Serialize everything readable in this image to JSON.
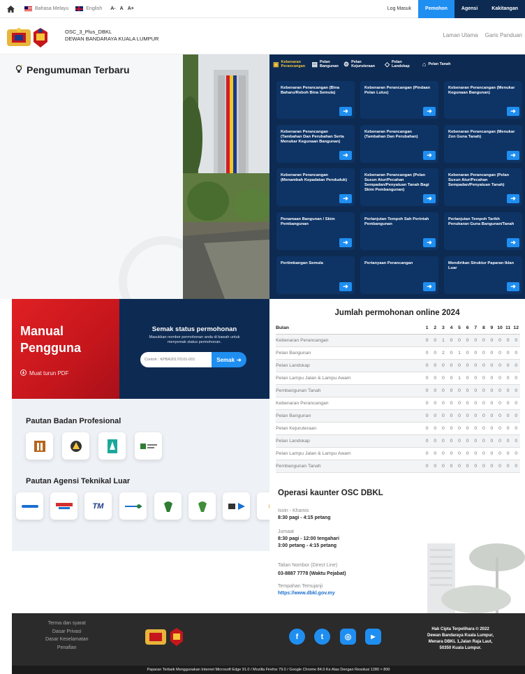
{
  "topbar": {
    "languages": [
      {
        "label": "Bahasa Melayu",
        "icon": "malaysia-flag-icon"
      },
      {
        "label": "English",
        "icon": "uk-flag-icon"
      }
    ],
    "font_sizes": [
      "A-",
      "A",
      "A+"
    ],
    "login": "Log Masuk",
    "tabs": [
      {
        "label": "Pemohon",
        "color": "#1f8ef1"
      },
      {
        "label": "Agensi",
        "color": "#0d2a52"
      },
      {
        "label": "Kakitangan",
        "color": "#0d2a52"
      }
    ]
  },
  "header": {
    "site_line1": "OSC_3_Plus_DBKL",
    "site_line2": "DEWAN BANDARAYA KUALA LUMPUR",
    "nav": [
      "Laman Utama",
      "Garis Panduan"
    ]
  },
  "announcements": {
    "title": "Pengumuman Terbaru"
  },
  "services": {
    "tabs": [
      {
        "label": "Kebenaran Perancangan",
        "icon": "document-icon"
      },
      {
        "label": "Pelan Bangunan",
        "icon": "building-icon"
      },
      {
        "label": "Pelan Kejuruteraan",
        "icon": "engineering-icon"
      },
      {
        "label": "Pelan Landskap",
        "icon": "landscape-icon"
      },
      {
        "label": "Pelan Tanah",
        "icon": "land-icon"
      }
    ],
    "cards": [
      "Kebenaran Perancangan (Bina Baharu/Roboh Bina Semula)",
      "Kebenaran Perancangan (Pindaan Pelan Lulus)",
      "Kebenaran Perancangan (Menukar Kegunaan Bangunan)",
      "Kebenaran Perancangan (Tambahan Dan Perubahan Serta Menukar Kegunaan Bangunan)",
      "Kebenaran Perancangan (Tambahan Dan Perubahan)",
      "Kebenaran Perancangan (Menukar Zon Guna Tanah)",
      "Kebenaran Perancangan (Menambah Kepadatan Penduduk)",
      "Kebenaran Perancangan (Pelan Susun Atur/Pecahan Sempadan/Penyatuan Tanah Bagi Skim Pembangunan)",
      "Kebenaran Perancangan (Pelan Susun Atur/Pecahan Sempadan/Penyatuan Tanah)",
      "Penamaan Bangunan / Skim Pembangunan",
      "Perlanjutan Tempoh Sah Perintah Pembangunan",
      "Perlanjutan Tempoh Tarikh Penukaran Guna Bangunan/Tanah",
      "Pertimbangan Semula",
      "Pertanyaan Perancangan",
      "Mendirikan Struktur Paparan Iklan Luar"
    ]
  },
  "manual": {
    "title_1": "Manual",
    "title_2": "Pengguna",
    "download": "Muat turun PDF"
  },
  "semak": {
    "title": "Semak status permohonan",
    "subtitle": "Masukkan nombor permohonan anda di bawah untuk menyemak status permohonan.",
    "placeholder": "Contoh : KPBA20170101-001",
    "button": "Semak"
  },
  "professional": {
    "title": "Pautan Badan Profesional",
    "items": [
      {
        "icon": "lam-logo-icon",
        "color": "#b5651d"
      },
      {
        "icon": "bem-logo-icon",
        "color": "#333333"
      },
      {
        "icon": "pam-logo-icon",
        "color": "#1aa89a"
      },
      {
        "icon": "rism-logo-icon",
        "color": "#2e7d32"
      }
    ]
  },
  "agencies": {
    "title": "Pautan Agensi Teknikal Luar",
    "items": [
      {
        "icon": "air-selangor-logo-icon",
        "label": "",
        "color": "#1a6fd0"
      },
      {
        "icon": "iwk-logo-icon",
        "label": "",
        "color": "#d32f2f"
      },
      {
        "icon": "tm-logo-icon",
        "label": "TM",
        "color": "#1b3a8a"
      },
      {
        "icon": "indah-water-logo-icon",
        "label": "",
        "color": "#1a6fd0"
      },
      {
        "icon": "jkr-logo-icon",
        "label": "",
        "color": "#2e7d32"
      },
      {
        "icon": "jps-logo-icon",
        "label": "",
        "color": "#2e7d32"
      },
      {
        "icon": "gas-malaysia-logo-icon",
        "label": "",
        "color": "#1a6fd0"
      }
    ]
  },
  "stats": {
    "title": "Jumlah permohonan online 2024",
    "col_label": "Bulan",
    "months": [
      "1",
      "2",
      "3",
      "4",
      "5",
      "6",
      "7",
      "8",
      "9",
      "10",
      "11",
      "12"
    ],
    "rows": [
      {
        "name": "Kebenaran Perancangan",
        "values": [
          "0",
          "0",
          "1",
          "0",
          "0",
          "0",
          "0",
          "0",
          "0",
          "0",
          "0",
          "0"
        ]
      },
      {
        "name": "Pelan Bangunan",
        "values": [
          "0",
          "0",
          "2",
          "0",
          "1",
          "0",
          "0",
          "0",
          "0",
          "0",
          "0",
          "0"
        ]
      },
      {
        "name": "Pelan Landskap",
        "values": [
          "0",
          "0",
          "0",
          "0",
          "0",
          "0",
          "0",
          "0",
          "0",
          "0",
          "0",
          "0"
        ]
      },
      {
        "name": "Pelan Lampu Jalan & Lampu Awam",
        "values": [
          "0",
          "0",
          "0",
          "0",
          "1",
          "0",
          "0",
          "0",
          "0",
          "0",
          "0",
          "0"
        ]
      },
      {
        "name": "Pembangunan Tanah",
        "values": [
          "0",
          "0",
          "0",
          "0",
          "0",
          "0",
          "0",
          "0",
          "0",
          "0",
          "0",
          "0"
        ]
      },
      {
        "name": "Kebenaran Perancangan",
        "values": [
          "0",
          "0",
          "0",
          "0",
          "0",
          "0",
          "0",
          "0",
          "0",
          "0",
          "0",
          "0"
        ]
      },
      {
        "name": "Pelan Bangunan",
        "values": [
          "0",
          "0",
          "0",
          "0",
          "0",
          "0",
          "0",
          "0",
          "0",
          "0",
          "0",
          "0"
        ]
      },
      {
        "name": "Pelan Kejuruteraan",
        "values": [
          "0",
          "0",
          "0",
          "0",
          "0",
          "0",
          "0",
          "0",
          "0",
          "0",
          "0",
          "0"
        ]
      },
      {
        "name": "Pelan Landskap",
        "values": [
          "0",
          "0",
          "0",
          "0",
          "0",
          "0",
          "0",
          "0",
          "0",
          "0",
          "0",
          "0"
        ]
      },
      {
        "name": "Pelan Lampu Jalan & Lampu Awam",
        "values": [
          "0",
          "0",
          "0",
          "0",
          "0",
          "0",
          "0",
          "0",
          "0",
          "0",
          "0",
          "0"
        ]
      },
      {
        "name": "Pembangunan Tanah",
        "values": [
          "0",
          "0",
          "0",
          "0",
          "0",
          "0",
          "0",
          "0",
          "0",
          "0",
          "0",
          "0"
        ]
      }
    ]
  },
  "operations": {
    "title": "Operasi kaunter OSC DBKL",
    "weekday_label": "Isnin - Khamis",
    "weekday_hours": "8:30 pagi - 4:15 petang",
    "friday_label": "Jumaat",
    "friday_hours_1": "8:30 pagi - 12:00 tengahari",
    "friday_hours_2": "3:00 petang - 4:15 petang",
    "phone_label": "Talian Nombor (Direct Line)",
    "phone": "03-8887 7778 (Waktu Pejabat)",
    "appt_label": "Tempahan Temujanji",
    "appt_link": "https://www.dbkl.gov.my"
  },
  "footer": {
    "links": [
      "Terma dan syarat",
      "Dasar Privasi",
      "Dasar Keselamatan",
      "Penafian"
    ],
    "social": [
      {
        "icon": "facebook-icon",
        "glyph": "f"
      },
      {
        "icon": "twitter-icon",
        "glyph": "t"
      },
      {
        "icon": "instagram-icon",
        "glyph": "◎"
      },
      {
        "icon": "youtube-icon",
        "glyph": "▶"
      }
    ],
    "copyright_1": "Hak Cipta Terpelihara © 2022",
    "copyright_2": "Dewan Bandaraya Kuala Lumpur,",
    "copyright_3": "Menara DBKL 1,Jalan Raja Laut,",
    "copyright_4": "50350 Kuala Lumpur.",
    "bottom_note": "Paparan Terbaik Menggunakan Internet Microsoft Edge 91.0 / Mozilla Firefox 79.0 / Google Chrome 84.0 Ke Atas Dengan Resolusi 1280 × 800"
  }
}
